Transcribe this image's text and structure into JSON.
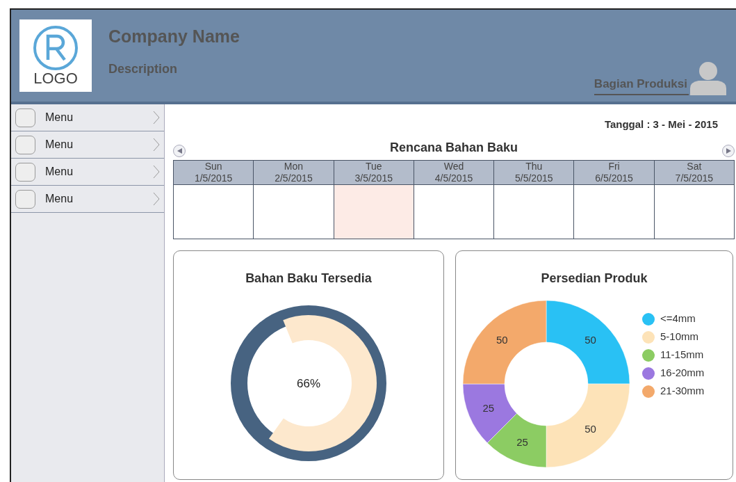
{
  "header": {
    "logo_text": "LOGO",
    "company_name": "Company Name",
    "description": "Description",
    "user_role": "Bagian Produksi"
  },
  "sidebar": {
    "items": [
      {
        "label": "Menu"
      },
      {
        "label": "Menu"
      },
      {
        "label": "Menu"
      },
      {
        "label": "Menu"
      }
    ]
  },
  "date_label": "Tanggal : 3 - Mei - 2015",
  "calendar": {
    "title": "Rencana Bahan Baku",
    "days": [
      {
        "day": "Sun",
        "date": "1/5/2015",
        "selected": false
      },
      {
        "day": "Mon",
        "date": "2/5/2015",
        "selected": false
      },
      {
        "day": "Tue",
        "date": "3/5/2015",
        "selected": true
      },
      {
        "day": "Wed",
        "date": "4/5/2015",
        "selected": false
      },
      {
        "day": "Thu",
        "date": "5/5/2015",
        "selected": false
      },
      {
        "day": "Fri",
        "date": "6/5/2015",
        "selected": false
      },
      {
        "day": "Sat",
        "date": "7/5/2015",
        "selected": false
      }
    ]
  },
  "stock_gauge": {
    "title": "Bahan Baku Tersedia",
    "reading": "66%"
  },
  "product_chart": {
    "title": "Persedian Produk",
    "legend": [
      {
        "label": "<=4mm",
        "color": "#29c1f4"
      },
      {
        "label": "5-10mm",
        "color": "#fde3b8"
      },
      {
        "label": "11-15mm",
        "color": "#8ccc63"
      },
      {
        "label": "16-20mm",
        "color": "#9b78e0"
      },
      {
        "label": "21-30mm",
        "color": "#f3a96b"
      }
    ],
    "chart_data": {
      "type": "donut",
      "values": [
        50,
        50,
        25,
        25,
        50
      ],
      "data_labels": true
    }
  }
}
